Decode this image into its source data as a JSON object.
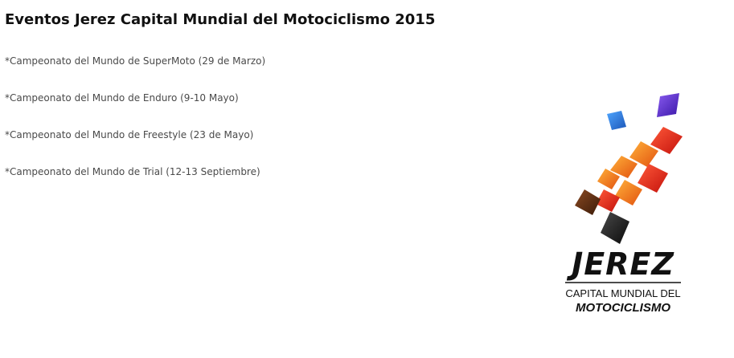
{
  "page": {
    "title": "Eventos Jerez Capital Mundial del Motociclismo 2015"
  },
  "events": [
    {
      "label": "*Campeonato del Mundo de SuperMoto (29 de Marzo)"
    },
    {
      "label": "*Campeonato del Mundo de Enduro (9-10 Mayo)"
    },
    {
      "label": "*Campeonato del Mundo de Freestyle (23 de Mayo)"
    },
    {
      "label": "*Campeonato del Mundo de Trial (12-13 Septiembre)"
    }
  ],
  "logo": {
    "name": "JEREZ",
    "line1": "CAPITAL MUNDIAL DEL",
    "line2": "MOTOCICLISMO",
    "colors": {
      "purple": "#5b2bd6",
      "blue": "#2f7fe0",
      "red": "#e3241c",
      "orange": "#f07a1a",
      "brown": "#5a2a12",
      "black": "#1a1a1a"
    }
  }
}
